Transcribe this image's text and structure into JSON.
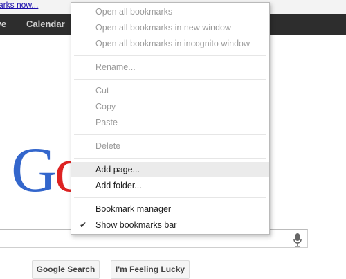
{
  "bookmarks_bar": {
    "partial_link": "arks now..."
  },
  "nav": {
    "items": [
      "ive",
      "Calendar"
    ]
  },
  "logo": {
    "letters": [
      "G",
      "o"
    ]
  },
  "search": {
    "google_search_button": "Google Search",
    "lucky_button": "I'm Feeling Lucky",
    "mic_icon": "microphone-icon"
  },
  "context_menu": {
    "open_all": "Open all bookmarks",
    "open_all_new_window": "Open all bookmarks in new window",
    "open_all_incognito": "Open all bookmarks in incognito window",
    "rename": "Rename...",
    "cut": "Cut",
    "copy": "Copy",
    "paste": "Paste",
    "delete": "Delete",
    "add_page": "Add page...",
    "add_folder": "Add folder...",
    "bookmark_manager": "Bookmark manager",
    "show_bookmarks_bar": "Show bookmarks bar",
    "check_glyph": "✔"
  },
  "colors": {
    "nav_bg": "#2d2d2d",
    "highlight": "#ebebeb",
    "disabled_text": "#9a9a9a"
  }
}
